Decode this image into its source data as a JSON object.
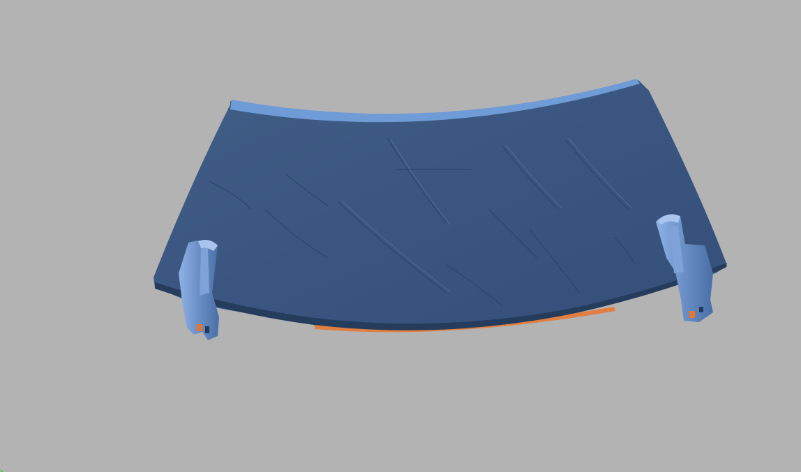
{
  "viewport": {
    "background_color": "#b3b3b3",
    "model": {
      "description_icon": "scanned-mesh-model",
      "surface_color": "#3d5a82",
      "edge_highlight_color": "#6f9bd6",
      "clip_color": "#6688bb",
      "backface_color": "#e8752d"
    },
    "axis_gizmo": {
      "icon": "axis-triad-icon",
      "color": "#2ecc40"
    }
  }
}
